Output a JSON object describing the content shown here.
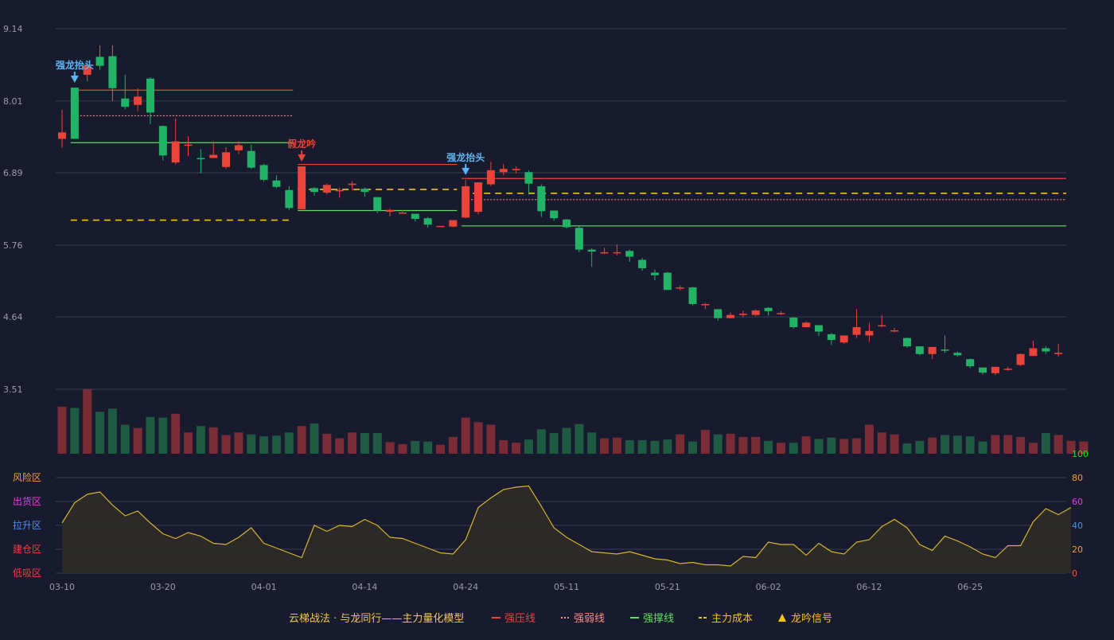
{
  "colors": {
    "background": "#181a2e",
    "up": "#e8443a",
    "down": "#22b366",
    "vol_up": "#7a2c36",
    "vol_down": "#1f5a43",
    "grid": "#3a3d52",
    "axis_text": "#9a9cae",
    "resist": "#e8443a",
    "weak": "#ff8c8c",
    "support": "#5fe05f",
    "cost": "#f2c31f",
    "signal_blue": "#5db4f2",
    "osc_line": "#d9b52a",
    "osc_fill": "#2e2c28",
    "zone_risk": "#f0a030",
    "zone_dist": "#e040e0",
    "zone_pull": "#4d8ef0",
    "zone_build": "#e84040",
    "zone_low": "#e84040",
    "tick_100": "#22dd22"
  },
  "chart_data": {
    "type": "candlestick",
    "y_axis_ticks": [
      "9.14",
      "8.01",
      "6.89",
      "5.76",
      "4.64",
      "3.51"
    ],
    "ylim": [
      3.51,
      9.14
    ],
    "x_axis_ticks": [
      {
        "label": "03-10",
        "index": 0
      },
      {
        "label": "03-20",
        "index": 8
      },
      {
        "label": "04-01",
        "index": 16
      },
      {
        "label": "04-14",
        "index": 24
      },
      {
        "label": "04-24",
        "index": 32
      },
      {
        "label": "05-11",
        "index": 40
      },
      {
        "label": "05-21",
        "index": 48
      },
      {
        "label": "06-02",
        "index": 56
      },
      {
        "label": "06-12",
        "index": 64
      },
      {
        "label": "06-25",
        "index": 72
      }
    ],
    "candles": [
      [
        7.42,
        7.52,
        7.87,
        7.28
      ],
      [
        8.22,
        7.42,
        8.22,
        7.42
      ],
      [
        8.42,
        8.56,
        8.56,
        8.32
      ],
      [
        8.7,
        8.56,
        8.88,
        8.5
      ],
      [
        8.71,
        8.21,
        8.88,
        8.01
      ],
      [
        8.05,
        7.92,
        8.42,
        7.88
      ],
      [
        7.95,
        8.08,
        8.21,
        7.85
      ],
      [
        8.36,
        7.83,
        8.38,
        7.65
      ],
      [
        7.62,
        7.16,
        7.63,
        7.08
      ],
      [
        7.05,
        7.38,
        7.74,
        7.02
      ],
      [
        7.33,
        7.33,
        7.46,
        7.15
      ],
      [
        7.12,
        7.1,
        7.26,
        6.88
      ],
      [
        7.12,
        7.17,
        7.38,
        7.12
      ],
      [
        6.98,
        7.21,
        7.29,
        6.95
      ],
      [
        7.24,
        7.32,
        7.38,
        7.18
      ],
      [
        7.23,
        6.97,
        7.33,
        6.95
      ],
      [
        7.01,
        6.78,
        7.03,
        6.75
      ],
      [
        6.77,
        6.67,
        6.85,
        6.65
      ],
      [
        6.62,
        6.34,
        6.68,
        6.31
      ],
      [
        6.32,
        6.99,
        6.99,
        6.32
      ],
      [
        6.65,
        6.59,
        6.67,
        6.53
      ],
      [
        6.58,
        6.7,
        6.72,
        6.55
      ],
      [
        6.6,
        6.62,
        6.66,
        6.5
      ],
      [
        6.7,
        6.72,
        6.76,
        6.62
      ],
      [
        6.64,
        6.59,
        6.66,
        6.52
      ],
      [
        6.51,
        6.3,
        6.51,
        6.26
      ],
      [
        6.28,
        6.31,
        6.33,
        6.21
      ],
      [
        6.27,
        6.27,
        6.31,
        6.25
      ],
      [
        6.25,
        6.17,
        6.25,
        6.13
      ],
      [
        6.18,
        6.08,
        6.2,
        6.03
      ],
      [
        6.06,
        6.06,
        6.06,
        6.06
      ],
      [
        6.05,
        6.15,
        6.15,
        6.04
      ],
      [
        6.19,
        6.68,
        6.78,
        6.18
      ],
      [
        6.28,
        6.74,
        6.74,
        6.24
      ],
      [
        6.71,
        6.93,
        7.06,
        6.68
      ],
      [
        6.9,
        6.95,
        7.03,
        6.85
      ],
      [
        6.93,
        6.95,
        6.99,
        6.88
      ],
      [
        6.9,
        6.72,
        6.93,
        6.55
      ],
      [
        6.68,
        6.29,
        6.71,
        6.2
      ],
      [
        6.3,
        6.18,
        6.3,
        6.14
      ],
      [
        6.16,
        6.04,
        6.17,
        6.02
      ],
      [
        6.03,
        5.69,
        6.05,
        5.65
      ],
      [
        5.69,
        5.66,
        5.71,
        5.42
      ],
      [
        5.63,
        5.65,
        5.72,
        5.62
      ],
      [
        5.65,
        5.65,
        5.77,
        5.6
      ],
      [
        5.67,
        5.58,
        5.69,
        5.5
      ],
      [
        5.53,
        5.4,
        5.56,
        5.36
      ],
      [
        5.33,
        5.29,
        5.38,
        5.21
      ],
      [
        5.33,
        5.06,
        5.34,
        5.06
      ],
      [
        5.1,
        5.1,
        5.13,
        5.05
      ],
      [
        5.1,
        4.84,
        5.11,
        4.82
      ],
      [
        4.84,
        4.84,
        4.86,
        4.76
      ],
      [
        4.76,
        4.62,
        4.76,
        4.58
      ],
      [
        4.62,
        4.67,
        4.71,
        4.62
      ],
      [
        4.67,
        4.69,
        4.74,
        4.63
      ],
      [
        4.67,
        4.74,
        4.76,
        4.65
      ],
      [
        4.78,
        4.73,
        4.79,
        4.66
      ],
      [
        4.7,
        4.7,
        4.73,
        4.67
      ],
      [
        4.63,
        4.48,
        4.63,
        4.46
      ],
      [
        4.48,
        4.55,
        4.57,
        4.48
      ],
      [
        4.51,
        4.41,
        4.51,
        4.34
      ],
      [
        4.37,
        4.28,
        4.39,
        4.2
      ],
      [
        4.24,
        4.35,
        4.35,
        4.22
      ],
      [
        4.36,
        4.48,
        4.76,
        4.31
      ],
      [
        4.35,
        4.42,
        4.55,
        4.25
      ],
      [
        4.51,
        4.51,
        4.67,
        4.48
      ],
      [
        4.43,
        4.43,
        4.47,
        4.4
      ],
      [
        4.31,
        4.18,
        4.32,
        4.16
      ],
      [
        4.18,
        4.06,
        4.18,
        4.04
      ],
      [
        4.06,
        4.17,
        4.17,
        3.98
      ],
      [
        4.13,
        4.12,
        4.35,
        4.08
      ],
      [
        4.08,
        4.04,
        4.1,
        4.02
      ],
      [
        3.98,
        3.87,
        3.99,
        3.84
      ],
      [
        3.85,
        3.77,
        3.85,
        3.74
      ],
      [
        3.76,
        3.86,
        3.86,
        3.73
      ],
      [
        3.82,
        3.83,
        3.86,
        3.8
      ],
      [
        3.89,
        4.06,
        4.07,
        3.87
      ],
      [
        4.03,
        4.15,
        4.27,
        4.03
      ],
      [
        4.15,
        4.1,
        4.18,
        4.06
      ],
      [
        4.06,
        4.08,
        4.22,
        4.02
      ]
    ],
    "volume_max": 100,
    "volume": [
      73,
      71,
      100,
      65,
      70,
      45,
      40,
      57,
      56,
      62,
      33,
      43,
      41,
      29,
      33,
      30,
      27,
      28,
      33,
      43,
      47,
      31,
      24,
      33,
      32,
      32,
      18,
      15,
      20,
      19,
      14,
      26,
      56,
      49,
      45,
      21,
      17,
      22,
      38,
      32,
      40,
      46,
      33,
      24,
      25,
      21,
      21,
      20,
      22,
      30,
      19,
      37,
      30,
      31,
      26,
      26,
      20,
      17,
      17,
      27,
      23,
      25,
      23,
      24,
      45,
      33,
      30,
      16,
      20,
      25,
      29,
      28,
      27,
      19,
      29,
      29,
      26,
      17,
      32,
      29,
      20,
      19
    ],
    "oscillator": {
      "levels": [
        0,
        20,
        40,
        60,
        80,
        100
      ],
      "zones": [
        "风险区",
        "出货区",
        "拉升区",
        "建仓区",
        "低吸区"
      ],
      "values": [
        42,
        59,
        66,
        68,
        57,
        48,
        52,
        42,
        33,
        29,
        34,
        31,
        25,
        24,
        30,
        38,
        25,
        21,
        17,
        13,
        40,
        35,
        40,
        39,
        45,
        40,
        30,
        29,
        25,
        21,
        17,
        16,
        28,
        55,
        63,
        70,
        72,
        73,
        56,
        38,
        30,
        24,
        18,
        17,
        16,
        18,
        15,
        12,
        11,
        8,
        9,
        7,
        7,
        6,
        14,
        13,
        26,
        24,
        24,
        15,
        25,
        18,
        16,
        26,
        28,
        39,
        45,
        38,
        24,
        19,
        31,
        27,
        22,
        16,
        13,
        23,
        23,
        43,
        54,
        49,
        55
      ]
    },
    "lines": [
      {
        "type": "resist",
        "start": 1,
        "end": 18,
        "y": 8.18
      },
      {
        "type": "weak",
        "start": 1,
        "end": 18,
        "y": 7.78
      },
      {
        "type": "support",
        "start": 1,
        "end": 18,
        "y": 7.36
      },
      {
        "type": "cost",
        "start": 1,
        "end": 18,
        "y": 6.15
      },
      {
        "type": "resist",
        "start": 19,
        "end": 31,
        "y": 7.02
      },
      {
        "type": "support",
        "start": 19,
        "end": 31,
        "y": 6.3
      },
      {
        "type": "cost",
        "start": 19,
        "end": 31,
        "y": 6.63
      },
      {
        "type": "resist",
        "start": 32,
        "end": 79,
        "y": 6.8
      },
      {
        "type": "weak",
        "start": 32,
        "end": 79,
        "y": 6.47
      },
      {
        "type": "support",
        "start": 32,
        "end": 79,
        "y": 6.06
      },
      {
        "type": "cost",
        "start": 32,
        "end": 79,
        "y": 6.57
      }
    ],
    "signals": [
      {
        "index": 1,
        "label": "强龙抬头",
        "kind": "blue"
      },
      {
        "index": 19,
        "label": "假龙吟",
        "kind": "red"
      },
      {
        "index": 32,
        "label": "强龙抬头",
        "kind": "blue"
      }
    ],
    "legend": {
      "title": "云梯战法 · 与龙同行——主力量化模型",
      "items": [
        {
          "label": "强压线",
          "style": "solid",
          "color_key": "resist"
        },
        {
          "label": "强弱线",
          "style": "dotted",
          "color_key": "weak"
        },
        {
          "label": "强撑线",
          "style": "solid",
          "color_key": "support"
        },
        {
          "label": "主力成本",
          "style": "dashed",
          "color_key": "cost"
        },
        {
          "label": "龙吟信号",
          "style": "triangle",
          "color_key": "cost"
        }
      ]
    }
  }
}
